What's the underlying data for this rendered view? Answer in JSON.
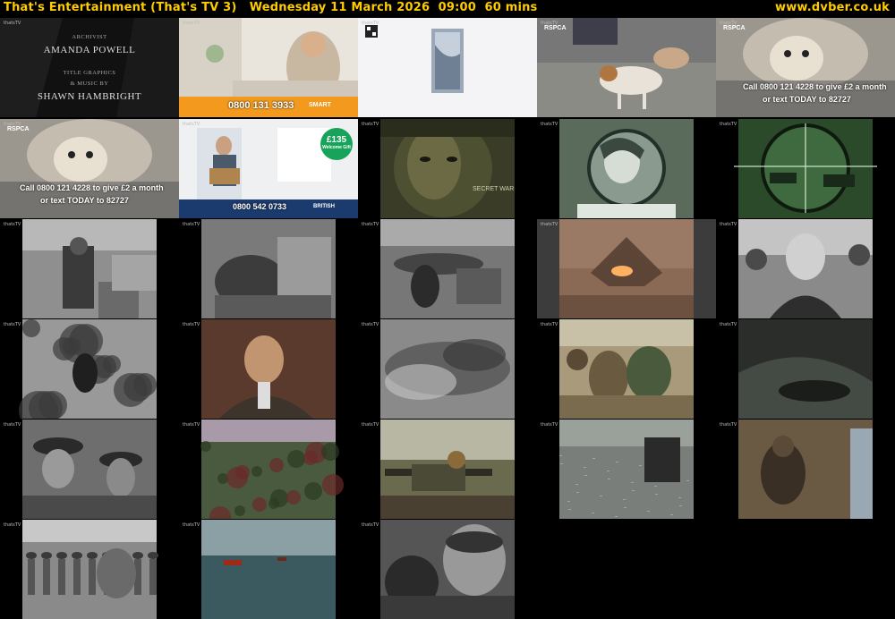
{
  "header": {
    "title": "That's Entertainment (That's TV 3)   Wednesday 11 March 2026  09:00  60 mins",
    "site": "www.dvber.co.uk"
  },
  "colors": {
    "accent": "#ffcc00",
    "background": "#000000"
  },
  "thumbnails": [
    {
      "id": 1,
      "kind": "credits",
      "credits": [
        {
          "role": "ARCHIVIST",
          "name": "AMANDA POWELL"
        },
        {
          "role": "TITLE GRAPHICS",
          "name": ""
        },
        {
          "role": "& MUSIC BY",
          "name": "SHAWN HAMBRIGHT"
        }
      ]
    },
    {
      "id": 2,
      "kind": "advert",
      "phone": "0800 131 3933",
      "brand": "SMART"
    },
    {
      "id": 3,
      "kind": "advert-phone-case"
    },
    {
      "id": 4,
      "kind": "rspca-dog",
      "brand": "RSPCA"
    },
    {
      "id": 5,
      "kind": "rspca-call",
      "brand": "RSPCA",
      "line1": "Call 0800 121 4228 to give £2 a month",
      "line2": "or text TODAY to 82727"
    },
    {
      "id": 6,
      "kind": "rspca-call",
      "brand": "RSPCA",
      "line1": "Call 0800 121 4228 to give £2 a month",
      "line2": "or text TODAY to 82727"
    },
    {
      "id": 7,
      "kind": "advert-gift",
      "phone": "0800 542 0733",
      "gift_amount": "£135",
      "gift_label": "Welcome Gift",
      "brand": "BRITISH"
    },
    {
      "id": 8,
      "kind": "face-war",
      "title_overlay": "SECRET WAR"
    },
    {
      "id": 9,
      "kind": "woman-portrait"
    },
    {
      "id": 10,
      "kind": "scope-green"
    },
    {
      "id": 11,
      "kind": "bw-soldier"
    },
    {
      "id": 12,
      "kind": "bw-machine"
    },
    {
      "id": 13,
      "kind": "bw-aircraft"
    },
    {
      "id": 14,
      "kind": "jet-sepia"
    },
    {
      "id": 15,
      "kind": "bw-leader"
    },
    {
      "id": 16,
      "kind": "bw-jungle"
    },
    {
      "id": 17,
      "kind": "interview"
    },
    {
      "id": 18,
      "kind": "bw-blur"
    },
    {
      "id": 19,
      "kind": "colour-soldiers"
    },
    {
      "id": 20,
      "kind": "dark-trench"
    },
    {
      "id": 21,
      "kind": "bw-helmets"
    },
    {
      "id": 22,
      "kind": "colour-jungle"
    },
    {
      "id": 23,
      "kind": "gun-colour"
    },
    {
      "id": 24,
      "kind": "bw-field-gun"
    },
    {
      "id": 25,
      "kind": "colour-gunner"
    },
    {
      "id": 26,
      "kind": "bw-march"
    },
    {
      "id": 27,
      "kind": "river-boats"
    },
    {
      "id": 28,
      "kind": "bw-soldier-close"
    }
  ],
  "watermark": "thatsTV"
}
